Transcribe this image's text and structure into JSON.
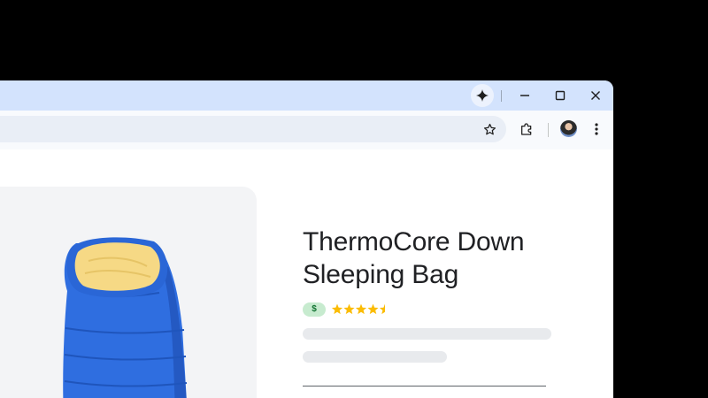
{
  "window": {
    "titlebar": {
      "icons": {
        "gemini": "gemini-sparkle-icon",
        "minimize": "minimize-icon",
        "maximize": "maximize-icon",
        "close": "close-icon"
      }
    },
    "toolbar": {
      "omnibox": {
        "value": ""
      },
      "icons": {
        "bookmark": "star-outline-icon",
        "extensions": "puzzle-piece-icon",
        "profile": "avatar",
        "menu": "three-dot-menu-icon"
      }
    }
  },
  "product": {
    "title_line_1": "ThermoCore Down",
    "title_line_2": "Sleeping Bag",
    "price_badge": "$",
    "rating": {
      "value": 4.5,
      "max": 5
    },
    "image": "blue-down-sleeping-bag"
  },
  "colors": {
    "titlebar": "#d3e3fd",
    "toolbar": "#f8fafd",
    "omnibox": "#e9eef6",
    "star": "#fbbc04",
    "price_badge_bg": "#c7ebcf",
    "price_badge_text": "#137333",
    "skeleton": "#e8eaed",
    "bag_blue": "#2f6ee0",
    "bag_lining": "#f6d985"
  }
}
